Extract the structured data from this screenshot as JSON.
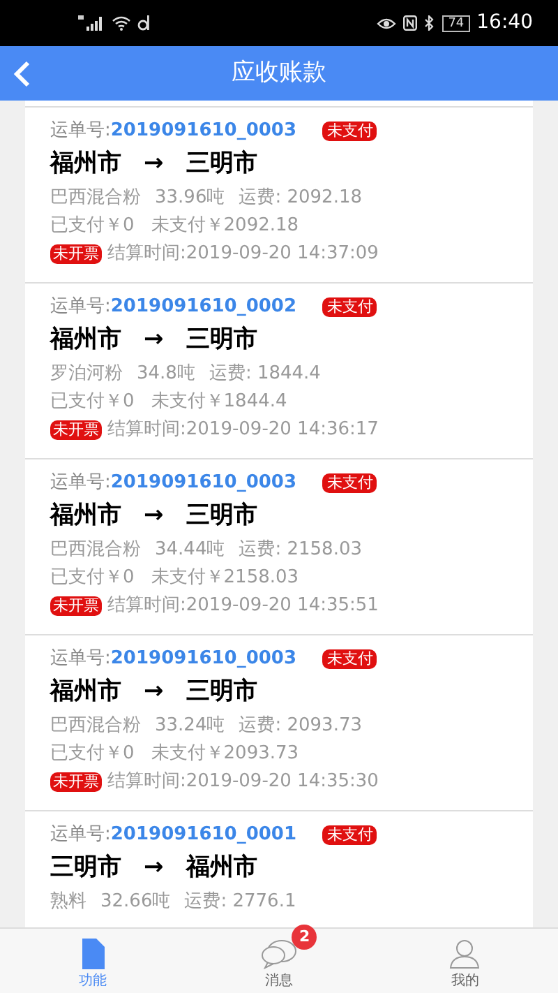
{
  "status_bar": {
    "battery": "74",
    "time": "16:40"
  },
  "header": {
    "title": "应收账款"
  },
  "orders": [
    {
      "label": "运单号:",
      "number": "2019091610_0003",
      "pay_status": "未支付",
      "from": "福州市",
      "arrow": "→",
      "to": "三明市",
      "cargo": "巴西混合粉",
      "weight": "33.96吨",
      "fee": "运费: 2092.18",
      "paid": "已支付￥0",
      "unpaid": "未支付￥2092.18",
      "invoice": "未开票",
      "settled": "结算时间:2019-09-20 14:37:09"
    },
    {
      "label": "运单号:",
      "number": "2019091610_0002",
      "pay_status": "未支付",
      "from": "福州市",
      "arrow": "→",
      "to": "三明市",
      "cargo": "罗泊河粉",
      "weight": "34.8吨",
      "fee": "运费: 1844.4",
      "paid": "已支付￥0",
      "unpaid": "未支付￥1844.4",
      "invoice": "未开票",
      "settled": "结算时间:2019-09-20 14:36:17"
    },
    {
      "label": "运单号:",
      "number": "2019091610_0003",
      "pay_status": "未支付",
      "from": "福州市",
      "arrow": "→",
      "to": "三明市",
      "cargo": "巴西混合粉",
      "weight": "34.44吨",
      "fee": "运费: 2158.03",
      "paid": "已支付￥0",
      "unpaid": "未支付￥2158.03",
      "invoice": "未开票",
      "settled": "结算时间:2019-09-20 14:35:51"
    },
    {
      "label": "运单号:",
      "number": "2019091610_0003",
      "pay_status": "未支付",
      "from": "福州市",
      "arrow": "→",
      "to": "三明市",
      "cargo": "巴西混合粉",
      "weight": "33.24吨",
      "fee": "运费: 2093.73",
      "paid": "已支付￥0",
      "unpaid": "未支付￥2093.73",
      "invoice": "未开票",
      "settled": "结算时间:2019-09-20 14:35:30"
    },
    {
      "label": "运单号:",
      "number": "2019091610_0001",
      "pay_status": "未支付",
      "from": "三明市",
      "arrow": "→",
      "to": "福州市",
      "cargo": "熟料",
      "weight": "32.66吨",
      "fee": "运费: 2776.1"
    }
  ],
  "tabs": [
    {
      "kind": "doc",
      "label": "功能",
      "selected": true
    },
    {
      "kind": "chat",
      "label": "消息",
      "selected": false,
      "badge": "2"
    },
    {
      "kind": "person",
      "label": "我的",
      "selected": false
    }
  ]
}
